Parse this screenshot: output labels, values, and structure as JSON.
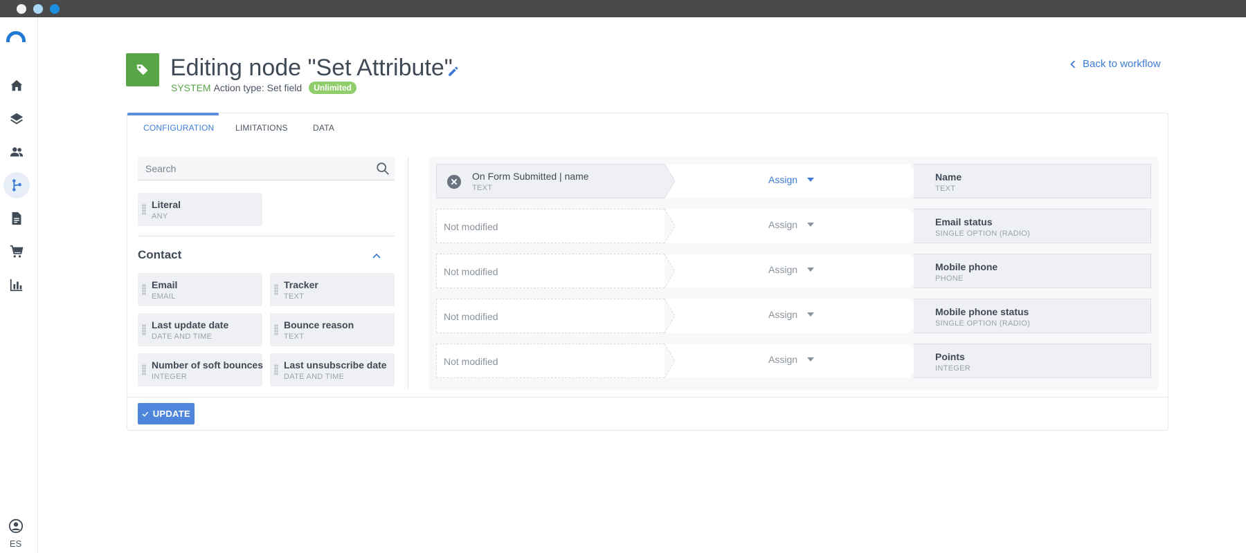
{
  "header": {
    "title": "Editing node \"Set Attribute\"",
    "system_label": "SYSTEM",
    "action_type": "Action type: Set field",
    "badge": "Unlimited",
    "back_link": "Back to workflow",
    "node_icon": "tag-icon"
  },
  "sidebar": {
    "items": [
      {
        "icon": "home-icon"
      },
      {
        "icon": "layers-icon"
      },
      {
        "icon": "users-icon"
      },
      {
        "icon": "workflow-icon",
        "active": true
      },
      {
        "icon": "document-icon"
      },
      {
        "icon": "cart-icon"
      },
      {
        "icon": "bar-chart-icon"
      }
    ],
    "user_language": "ES"
  },
  "tabs": [
    {
      "label": "CONFIGURATION",
      "active": true
    },
    {
      "label": "LIMITATIONS"
    },
    {
      "label": "DATA"
    }
  ],
  "fields_panel": {
    "search_placeholder": "Search",
    "literal": {
      "label": "Literal",
      "type": "ANY"
    },
    "section_title": "Contact",
    "fields": [
      {
        "label": "Email",
        "type": "EMAIL"
      },
      {
        "label": "Tracker",
        "type": "TEXT"
      },
      {
        "label": "Last update date",
        "type": "DATE AND TIME"
      },
      {
        "label": "Bounce reason",
        "type": "TEXT"
      },
      {
        "label": "Number of soft bounces",
        "type": "INTEGER"
      },
      {
        "label": "Last unsubscribe date",
        "type": "DATE AND TIME"
      }
    ]
  },
  "mappings": [
    {
      "source": "On Form Submitted | name",
      "source_type": "TEXT",
      "operation": "Assign",
      "target": "Name",
      "target_type": "TEXT"
    },
    {
      "source": "Not modified",
      "operation": "Assign",
      "target": "Email status",
      "target_type": "SINGLE OPTION (RADIO)"
    },
    {
      "source": "Not modified",
      "operation": "Assign",
      "target": "Mobile phone",
      "target_type": "PHONE"
    },
    {
      "source": "Not modified",
      "operation": "Assign",
      "target": "Mobile phone status",
      "target_type": "SINGLE OPTION (RADIO)"
    },
    {
      "source": "Not modified",
      "operation": "Assign",
      "target": "Points",
      "target_type": "INTEGER"
    }
  ],
  "footer": {
    "update_label": "UPDATE"
  },
  "colors": {
    "accent": "#3d7bd6",
    "success": "#58a548",
    "badge": "#8fce6a",
    "button": "#4f86dc"
  }
}
